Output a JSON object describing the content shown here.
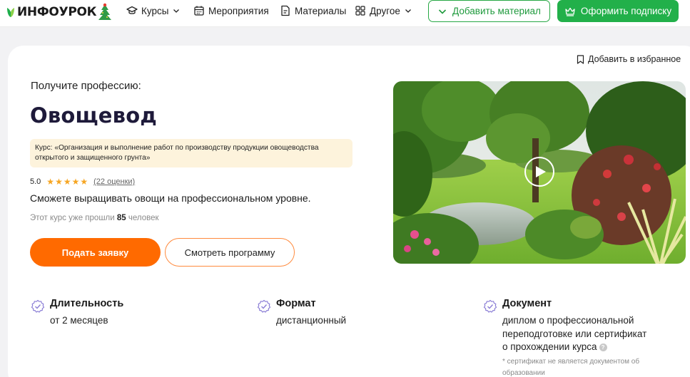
{
  "header": {
    "logo_text": "ИНФОУРОК",
    "nav": [
      {
        "label": "Курсы",
        "icon": "graduation-cap-icon"
      },
      {
        "label": "Мероприятия",
        "icon": "calendar-icon"
      },
      {
        "label": "Материалы",
        "icon": "document-icon"
      },
      {
        "label": "Другое",
        "icon": "grid-icon"
      }
    ],
    "add_material_label": "Добавить материал",
    "subscribe_label": "Оформить подписку"
  },
  "card": {
    "favorite_label": "Добавить в избранное",
    "get_profession": "Получите профессию:",
    "title": "Овощевод",
    "course_description": "Курс: «Организация и выполнение работ по производству продукции овощеводства открытого и защищенного грунта»",
    "rating_value": "5.0",
    "rating_stars": 5,
    "rating_count": "(22 оценки)",
    "subtitle": "Сможете выращивать овощи на профессиональном уровне.",
    "passed_prefix": "Этот курс уже прошли",
    "passed_count": "85",
    "passed_suffix": "человек",
    "apply_label": "Подать заявку",
    "program_label": "Смотреть программу"
  },
  "features": [
    {
      "label": "Длительность",
      "value": "от 2 месяцев"
    },
    {
      "label": "Формат",
      "value": "дистанционный"
    },
    {
      "label": "Документ",
      "value_lines": [
        "диплом о профессиональной",
        "переподготовке или сертификат",
        "о прохождении курса"
      ],
      "note": "* сертификат не является документом об образовании"
    }
  ],
  "colors": {
    "brand_green": "#22b04a",
    "accent_orange": "#ff6a00",
    "title_navy": "#1e1a3a",
    "star": "#f6a623",
    "feature_icon": "#8c7fd6"
  }
}
